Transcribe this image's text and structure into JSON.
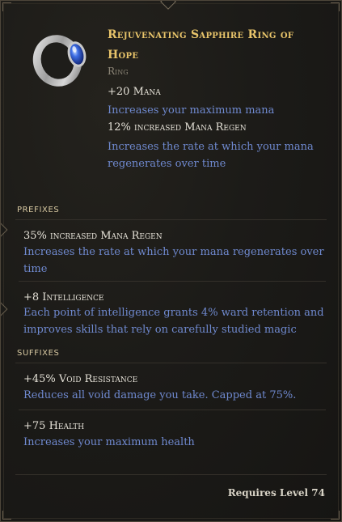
{
  "item": {
    "name": "Rejuvenating Sapphire Ring of Hope",
    "type": "Ring",
    "icon": "sapphire-ring-icon",
    "name_color": "#e8c46a"
  },
  "implicits": [
    {
      "stat": "+20 Mana",
      "description": "Increases your maximum mana"
    },
    {
      "stat": "12% increased Mana Regen",
      "description": "Increases the rate at which your mana regenerates over time"
    }
  ],
  "prefixes": {
    "label": "PREFIXES",
    "items": [
      {
        "stat": "35% increased Mana Regen",
        "description": "Increases the rate at which your mana regenerates over time"
      },
      {
        "stat": "+8 Intelligence",
        "description": "Each point of intelligence grants 4% ward retention and improves skills that rely on carefully studied magic"
      }
    ]
  },
  "suffixes": {
    "label": "SUFFIXES",
    "items": [
      {
        "stat": "+45% Void Resistance",
        "description": "Reduces all void damage you take. Capped at 75%."
      },
      {
        "stat": "+75 Health",
        "description": "Increases your maximum health"
      }
    ]
  },
  "requirement": "Requires Level 74",
  "colors": {
    "stat_text": "#e6e2d8",
    "description_text": "#6f89cf",
    "section_label": "#d8c9a2"
  }
}
